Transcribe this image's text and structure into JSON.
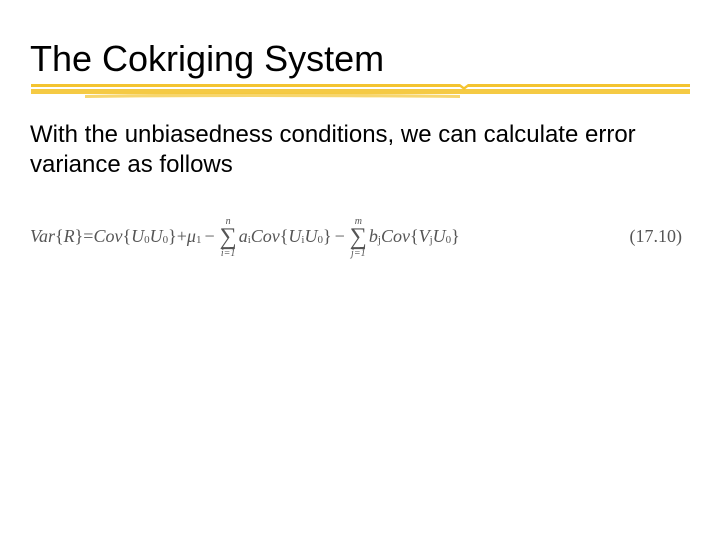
{
  "title": "The Cokriging System",
  "body": "With the unbiasedness conditions, we can calculate error variance as follows",
  "equation": {
    "lhs_var": "Var",
    "lhs_arg": "R",
    "eq": "=",
    "cov": "Cov",
    "u0u0_a": "U",
    "u0u0_a_sub": "0",
    "u0u0_b": "U",
    "u0u0_b_sub": "0",
    "plus": "+",
    "mu": "μ",
    "mu_sub": "1",
    "minus1": "−",
    "sum1_top": "n",
    "sum1_bot": "i=1",
    "a": "a",
    "a_sub": "i",
    "ui": "U",
    "ui_sub": "i",
    "u0c": "U",
    "u0c_sub": "0",
    "minus2": "−",
    "sum2_top": "m",
    "sum2_bot": "j=1",
    "b": "b",
    "b_sub": "j",
    "vj": "V",
    "vj_sub": "j",
    "u0d": "U",
    "u0d_sub": "0"
  },
  "equation_number": "(17.10)"
}
